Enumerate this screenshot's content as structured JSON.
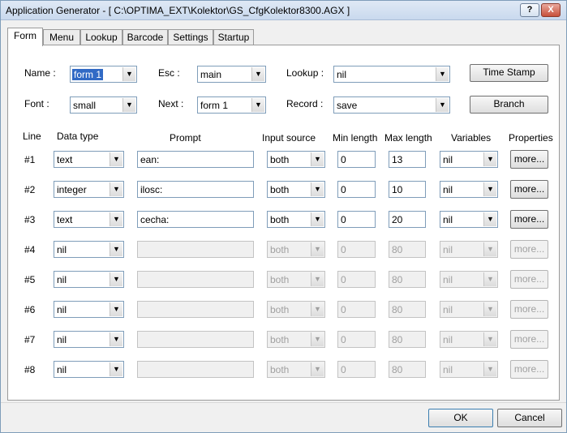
{
  "window": {
    "title": "Application Generator - [ C:\\OPTIMA_EXT\\Kolektor\\GS_CfgKolektor8300.AGX ]",
    "help_label": "?",
    "close_label": "X"
  },
  "tabs": [
    {
      "label": "Form",
      "active": true
    },
    {
      "label": "Menu"
    },
    {
      "label": "Lookup"
    },
    {
      "label": "Barcode"
    },
    {
      "label": "Settings"
    },
    {
      "label": "Startup"
    }
  ],
  "form": {
    "name_label": "Name :",
    "name_value": "form  1",
    "esc_label": "Esc  :",
    "esc_value": "main",
    "lookup_label": "Lookup :",
    "lookup_value": "nil",
    "font_label": "Font :",
    "font_value": "small",
    "next_label": "Next :",
    "next_value": "form  1",
    "record_label": "Record :",
    "record_value": "save",
    "timestamp_button": "Time Stamp",
    "branch_button": "Branch"
  },
  "grid": {
    "headers": {
      "line": "Line",
      "data_type": "Data type",
      "prompt": "Prompt",
      "input_source": "Input source",
      "min_length": "Min length",
      "max_length": "Max length",
      "variables": "Variables",
      "properties": "Properties"
    },
    "more_label": "more...",
    "rows": [
      {
        "line": "#1",
        "data_type": "text",
        "prompt": "ean:",
        "input_source": "both",
        "min": "0",
        "max": "13",
        "variables": "nil"
      },
      {
        "line": "#2",
        "data_type": "integer",
        "prompt": "ilosc:",
        "input_source": "both",
        "min": "0",
        "max": "10",
        "variables": "nil"
      },
      {
        "line": "#3",
        "data_type": "text",
        "prompt": "cecha:",
        "input_source": "both",
        "min": "0",
        "max": "20",
        "variables": "nil"
      },
      {
        "line": "#4",
        "data_type": "nil",
        "prompt": "",
        "input_source": "both",
        "min": "0",
        "max": "80",
        "variables": "nil"
      },
      {
        "line": "#5",
        "data_type": "nil",
        "prompt": "",
        "input_source": "both",
        "min": "0",
        "max": "80",
        "variables": "nil"
      },
      {
        "line": "#6",
        "data_type": "nil",
        "prompt": "",
        "input_source": "both",
        "min": "0",
        "max": "80",
        "variables": "nil"
      },
      {
        "line": "#7",
        "data_type": "nil",
        "prompt": "",
        "input_source": "both",
        "min": "0",
        "max": "80",
        "variables": "nil"
      },
      {
        "line": "#8",
        "data_type": "nil",
        "prompt": "",
        "input_source": "both",
        "min": "0",
        "max": "80",
        "variables": "nil"
      }
    ]
  },
  "footer": {
    "ok": "OK",
    "cancel": "Cancel"
  }
}
